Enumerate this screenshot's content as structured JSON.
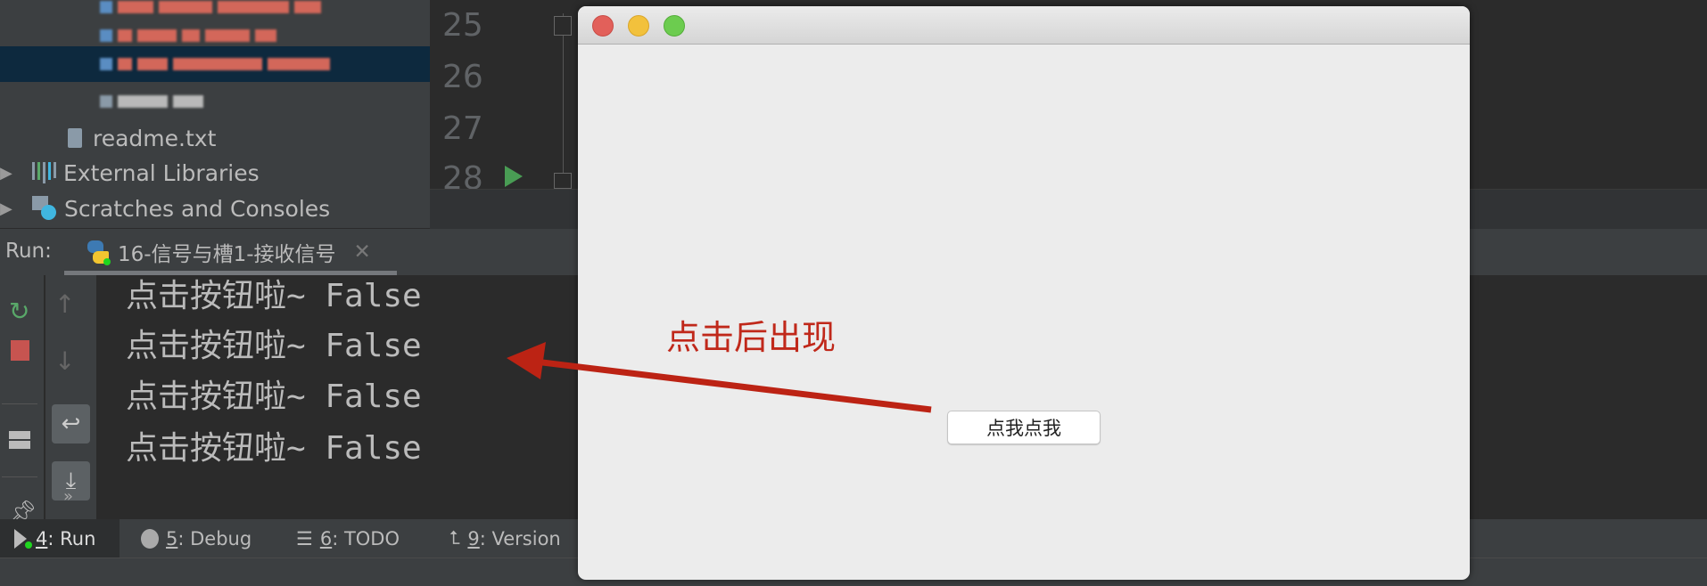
{
  "project_tree": {
    "items": [
      {
        "label": "readme.txt",
        "icon": "text-file-icon"
      },
      {
        "label": "External Libraries",
        "icon": "library-icon"
      },
      {
        "label": "Scratches and Consoles",
        "icon": "scratches-icon"
      }
    ]
  },
  "editor": {
    "line_numbers": [
      "25",
      "26",
      "27",
      "28"
    ]
  },
  "run_panel": {
    "label": "Run:",
    "tab_label": "16-信号与槽1-接收信号",
    "console_lines": [
      "点击按钮啦~ False",
      "点击按钮啦~ False",
      "点击按钮啦~ False",
      "点击按钮啦~ False"
    ]
  },
  "bottom_tabs": [
    {
      "key": "4",
      "label": ": Run"
    },
    {
      "key": "5",
      "label": ": Debug"
    },
    {
      "key": "6",
      "label": ": TODO"
    },
    {
      "key": "9",
      "label": ": Version"
    }
  ],
  "dialog": {
    "button_label": "点我点我"
  },
  "annotation": {
    "text": "点击后出现",
    "color": "#c0281a"
  }
}
